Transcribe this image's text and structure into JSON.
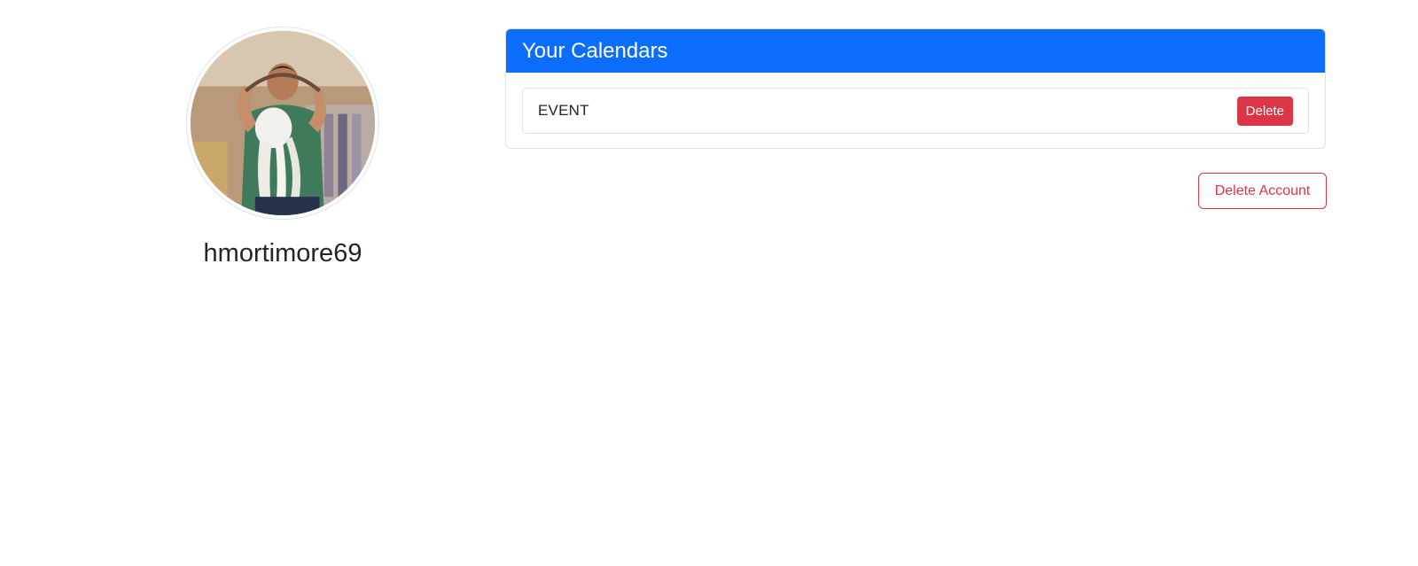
{
  "profile": {
    "username": "hmortimore69",
    "avatar_alt": "profile photo"
  },
  "calendars": {
    "header": "Your Calendars",
    "items": [
      {
        "label": "EVENT",
        "delete_label": "Delete"
      }
    ]
  },
  "account": {
    "delete_account_label": "Delete Account"
  },
  "colors": {
    "primary": "#0d6efd",
    "danger": "#dc3545",
    "border": "#dee2e6",
    "text": "#212529"
  }
}
